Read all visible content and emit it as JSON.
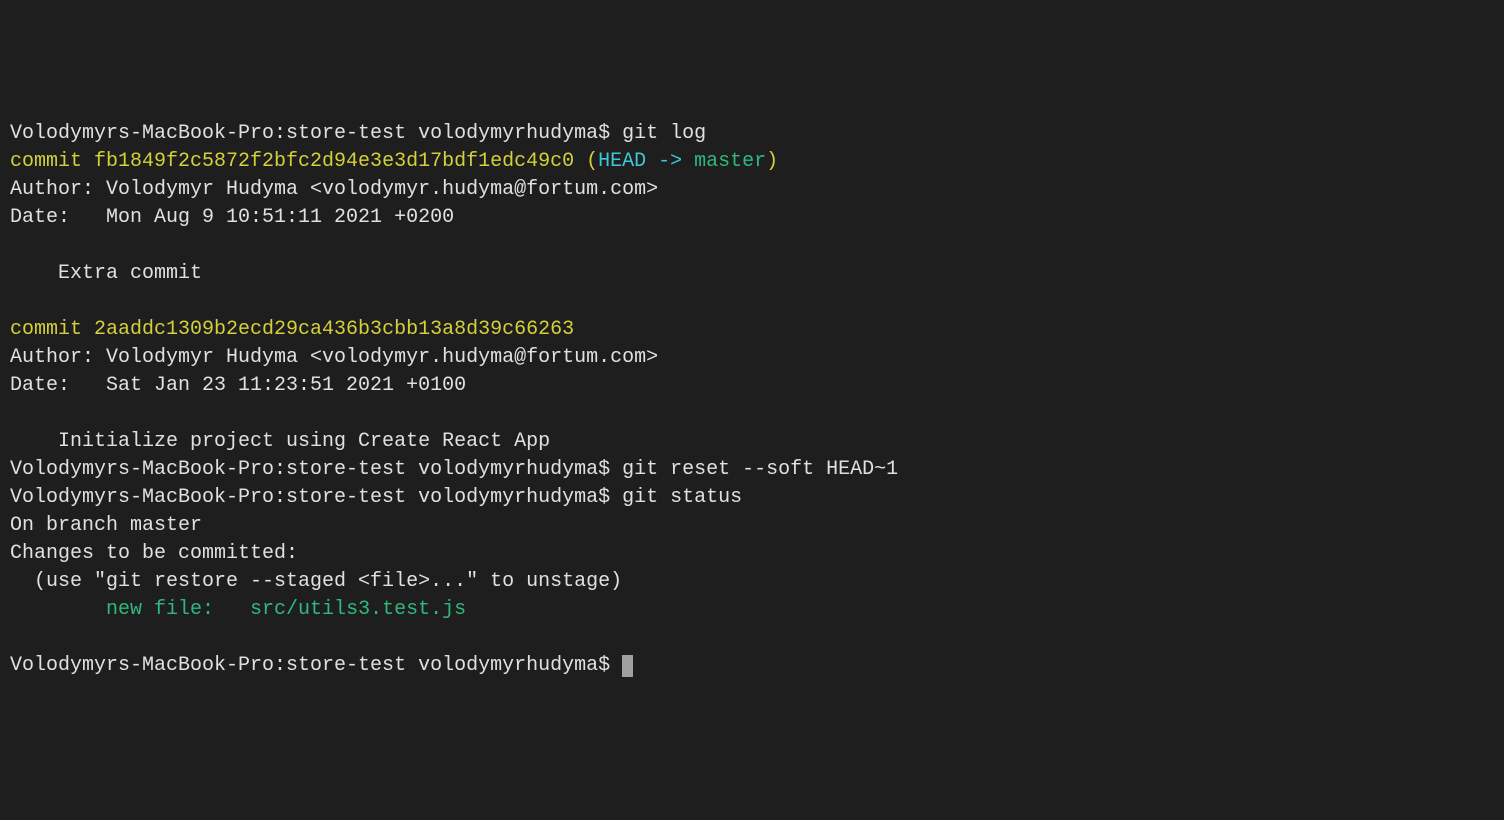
{
  "prompt": "Volodymyrs-MacBook-Pro:store-test volodymyrhudyma$ ",
  "commands": {
    "gitLog": "git log",
    "gitReset": "git reset --soft HEAD~1",
    "gitStatus": "git status"
  },
  "commits": [
    {
      "prefix": "commit ",
      "hash": "fb1849f2c5872f2bfc2d94e3e3d17bdf1edc49c0",
      "refOpen": " (",
      "headArrow": "HEAD -> ",
      "branch": "master",
      "refClose": ")",
      "author": "Author: Volodymyr Hudyma <volodymyr.hudyma@fortum.com>",
      "date": "Date:   Mon Aug 9 10:51:11 2021 +0200",
      "message": "    Extra commit"
    },
    {
      "prefix": "commit ",
      "hash": "2aaddc1309b2ecd29ca436b3cbb13a8d39c66263",
      "author": "Author: Volodymyr Hudyma <volodymyr.hudyma@fortum.com>",
      "date": "Date:   Sat Jan 23 11:23:51 2021 +0100",
      "message": "    Initialize project using Create React App"
    }
  ],
  "status": {
    "branch": "On branch master",
    "changesHeader": "Changes to be committed:",
    "hint": "  (use \"git restore --staged <file>...\" to unstage)",
    "newFileLabel": "        new file:   ",
    "newFilePath": "src/utils3.test.js"
  }
}
